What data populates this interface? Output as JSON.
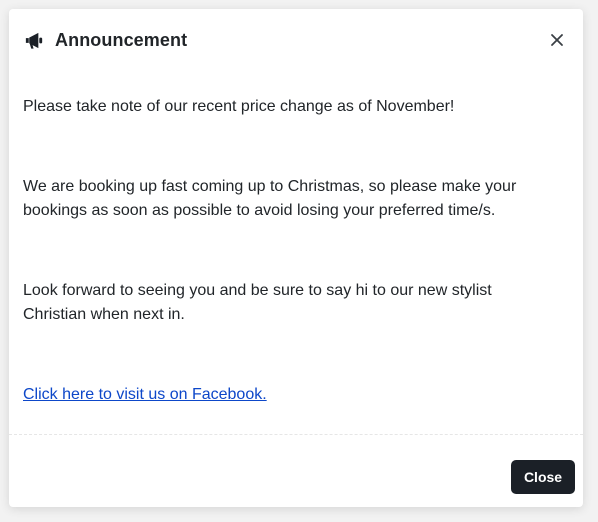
{
  "modal": {
    "title": "Announcement",
    "title_icon": "megaphone-icon",
    "close_icon": "close-icon",
    "body": {
      "paragraph_1": "Please take note of our recent price change as of November!",
      "paragraph_2": "We are booking up fast coming up to Christmas, so please make your bookings as soon as possible to avoid losing your preferred time/s.",
      "paragraph_3": "Look forward to seeing you and be sure to say hi to our new stylist Christian when next in.",
      "link_text": "Click here to visit us on Facebook."
    },
    "footer": {
      "close_label": "Close"
    }
  },
  "colors": {
    "link": "#0d47c9",
    "button_bg": "#1b2027",
    "text": "#212529"
  }
}
